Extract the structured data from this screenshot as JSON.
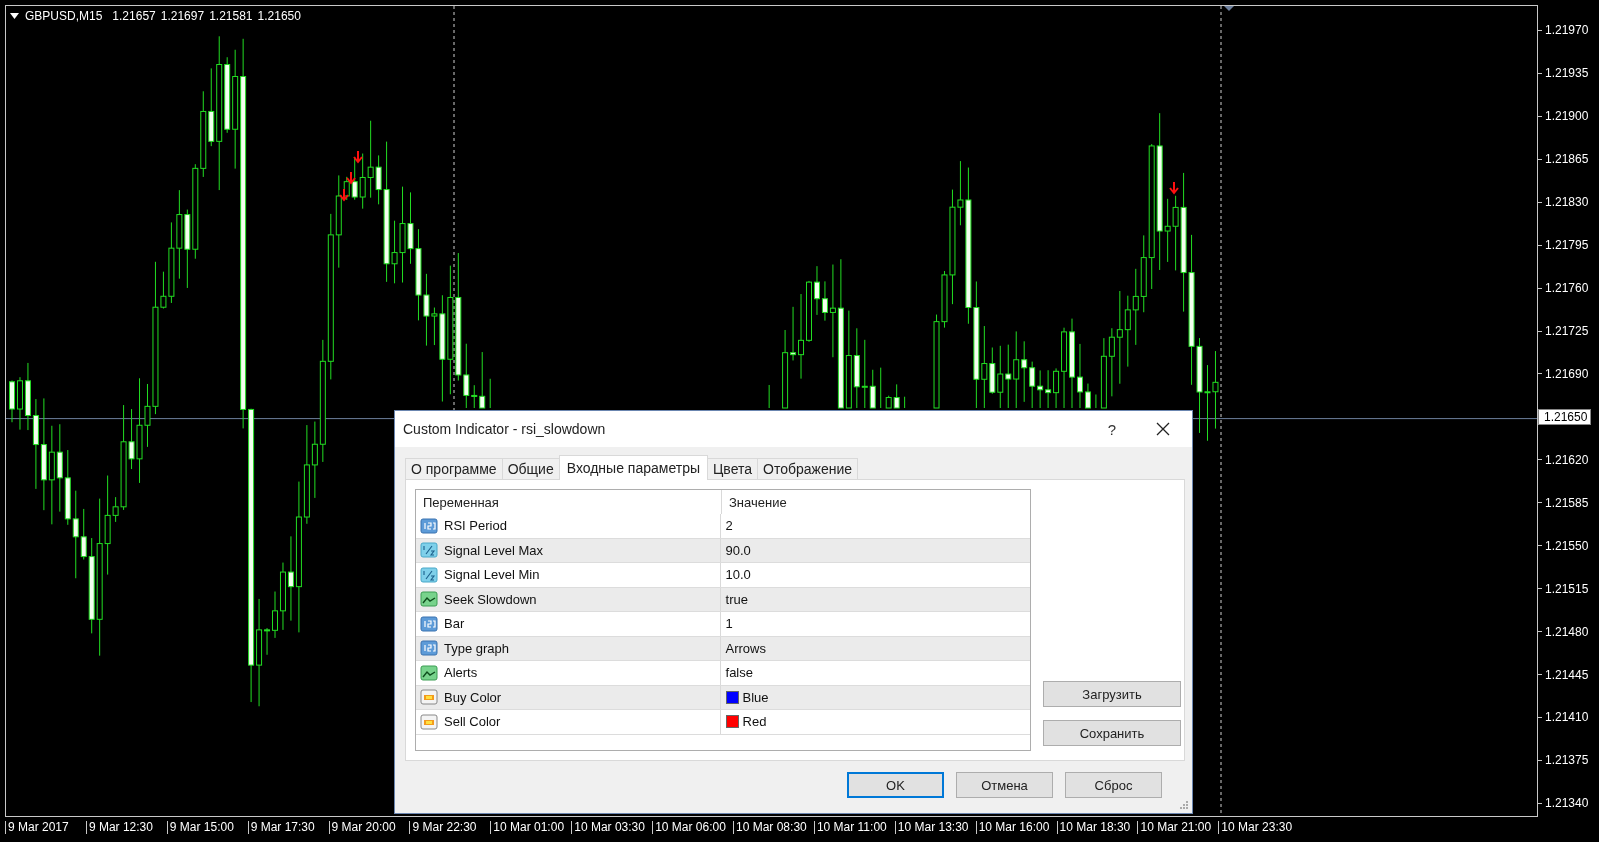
{
  "chart": {
    "symbol": "GBPUSD,M15",
    "quotes": [
      "1.21657",
      "1.21697",
      "1.21581",
      "1.21650"
    ],
    "price_axis": [
      {
        "kind": "tick",
        "label": "1.21970"
      },
      {
        "kind": "tick",
        "label": "1.21935"
      },
      {
        "kind": "tick",
        "label": "1.21900"
      },
      {
        "kind": "tick",
        "label": "1.21865"
      },
      {
        "kind": "tick",
        "label": "1.21830"
      },
      {
        "kind": "tick",
        "label": "1.21795"
      },
      {
        "kind": "tick",
        "label": "1.21760"
      },
      {
        "kind": "tick",
        "label": "1.21725"
      },
      {
        "kind": "tick",
        "label": "1.21690"
      },
      {
        "kind": "current",
        "label": "1.21650"
      },
      {
        "kind": "tick",
        "label": "1.21620"
      },
      {
        "kind": "tick",
        "label": "1.21585"
      },
      {
        "kind": "tick",
        "label": "1.21550"
      },
      {
        "kind": "tick",
        "label": "1.21515"
      },
      {
        "kind": "tick",
        "label": "1.21480"
      },
      {
        "kind": "tick",
        "label": "1.21445"
      },
      {
        "kind": "tick",
        "label": "1.21410"
      },
      {
        "kind": "tick",
        "label": "1.21375"
      },
      {
        "kind": "tick",
        "label": "1.21340"
      }
    ],
    "time_axis": [
      "9 Mar 2017",
      "9 Mar 12:30",
      "9 Mar 15:00",
      "9 Mar 17:30",
      "9 Mar 20:00",
      "9 Mar 22:30",
      "10 Mar 01:00",
      "10 Mar 03:30",
      "10 Mar 06:00",
      "10 Mar 08:30",
      "10 Mar 11:00",
      "10 Mar 13:30",
      "10 Mar 16:00",
      "10 Mar 18:30",
      "10 Mar 21:00",
      "10 Mar 23:30"
    ]
  },
  "dialog": {
    "title": "Custom Indicator - rsi_slowdown",
    "help": "?",
    "tabs": [
      {
        "label": "О программе",
        "selected": false
      },
      {
        "label": "Общие",
        "selected": false
      },
      {
        "label": "Входные параметры",
        "selected": true
      },
      {
        "label": "Цвета",
        "selected": false
      },
      {
        "label": "Отображение",
        "selected": false
      }
    ],
    "columns": [
      "Переменная",
      "Значение"
    ],
    "rows": [
      {
        "kind": "int",
        "name": "RSI Period",
        "value": "2"
      },
      {
        "kind": "double",
        "name": "Signal Level Max",
        "value": "90.0"
      },
      {
        "kind": "double",
        "name": "Signal Level Min",
        "value": "10.0"
      },
      {
        "kind": "bool",
        "name": "Seek Slowdown",
        "value": "true"
      },
      {
        "kind": "int",
        "name": "Bar",
        "value": "1"
      },
      {
        "kind": "int",
        "name": "Type graph",
        "value": "Arrows"
      },
      {
        "kind": "bool",
        "name": "Alerts",
        "value": "false"
      },
      {
        "kind": "color",
        "name": "Buy Color",
        "value": "Blue",
        "color": "#0000ff"
      },
      {
        "kind": "color",
        "name": "Sell Color",
        "value": "Red",
        "color": "#ff0000"
      }
    ],
    "side_buttons": [
      "Загрузить",
      "Сохранить"
    ],
    "buttons": [
      {
        "label": "OK",
        "default": true
      },
      {
        "label": "Отмена",
        "default": false
      },
      {
        "label": "Сброс",
        "default": false
      }
    ]
  }
}
